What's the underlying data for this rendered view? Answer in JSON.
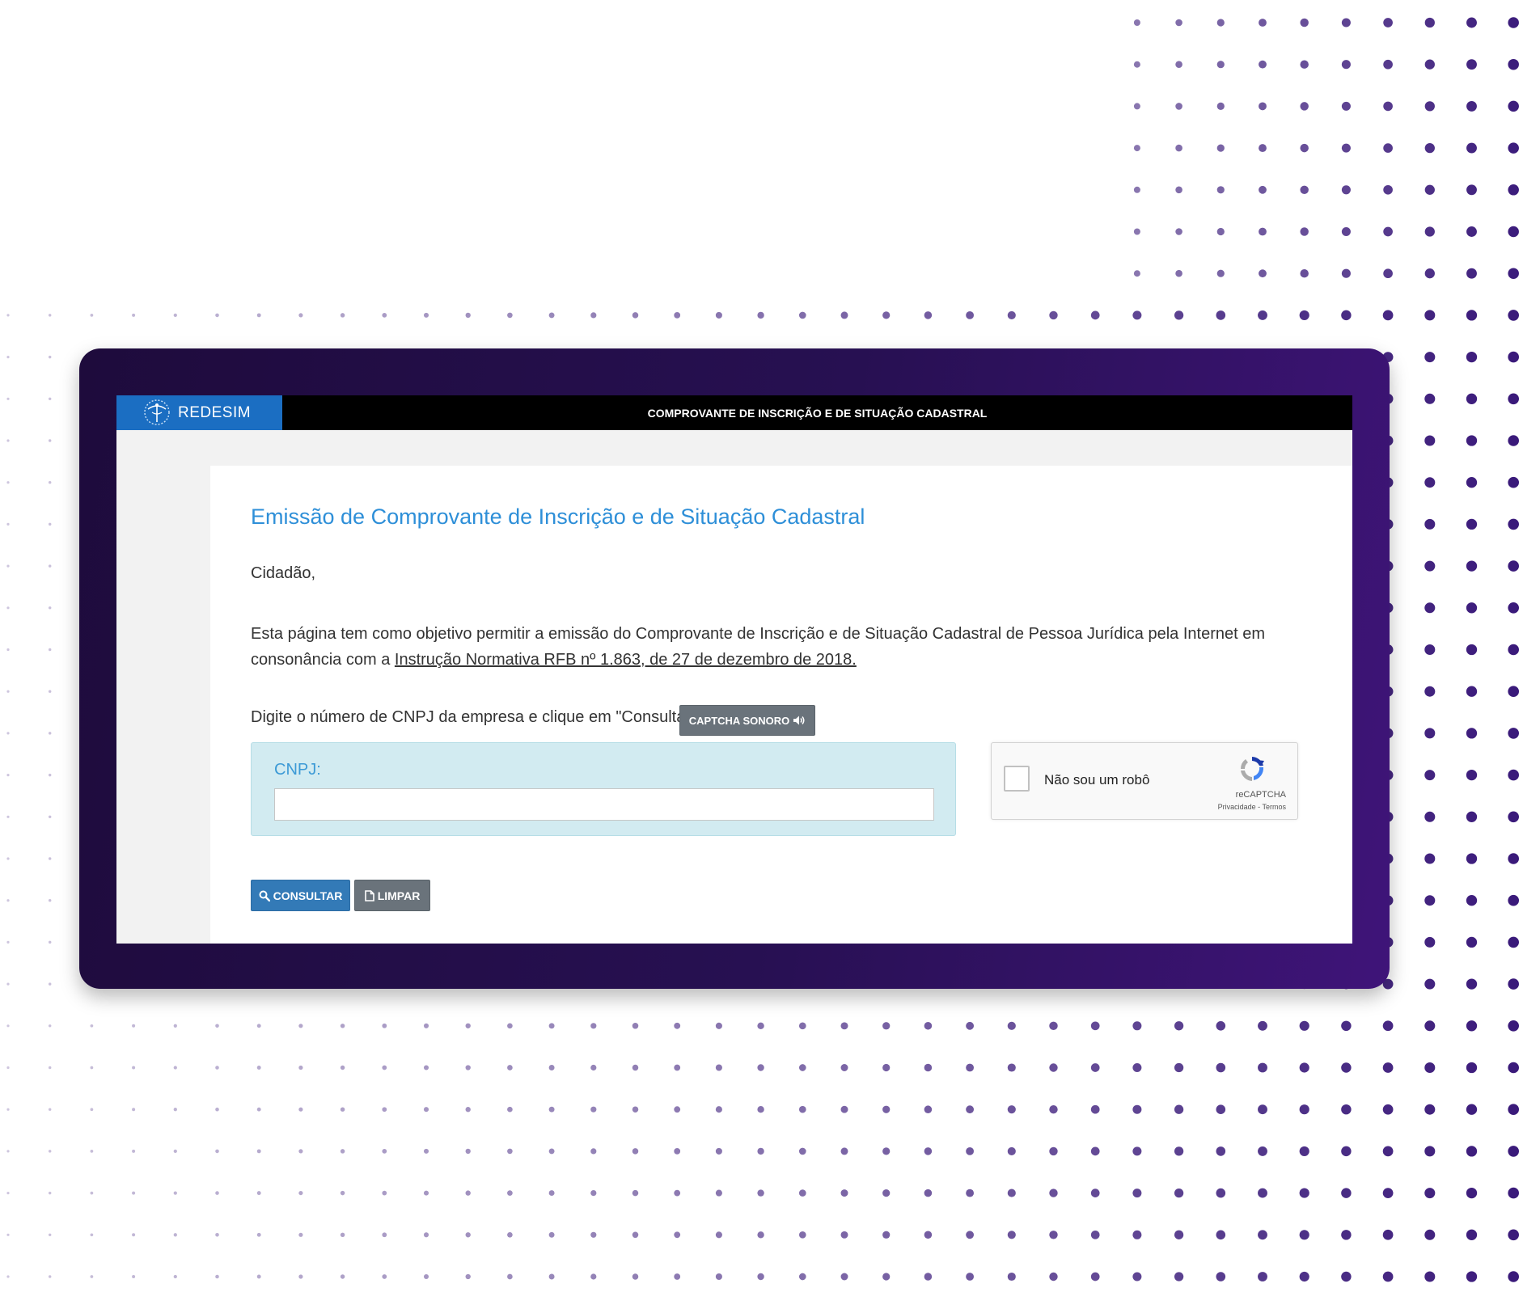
{
  "colors": {
    "frame_gradient": [
      "#1e0b3c",
      "#3f1479"
    ],
    "brand_blue": "#1b6ec2",
    "title_blue": "#2e8fd8",
    "dot_purple": "#3a1a7a",
    "cnpj_box_bg": "#d2ebf1",
    "button_primary": "#337ab7",
    "button_secondary": "#6a737b"
  },
  "header": {
    "brand_name": "REDESIM",
    "brand_icon": "redesim-globe-icon",
    "title": "COMPROVANTE DE INSCRIÇÃO E DE SITUAÇÃO CADASTRAL"
  },
  "main": {
    "title": "Emissão de Comprovante de Inscrição e de Situação Cadastral",
    "greeting": "Cidadão,",
    "intro_text": "Esta página tem como objetivo permitir a emissão do Comprovante de Inscrição e de Situação Cadastral de Pessoa Jurídica pela Internet em consonância com a ",
    "intro_link": "Instrução Normativa RFB nº 1.863, de 27 de dezembro de 2018.",
    "instruction": "Digite o número de CNPJ da empresa e clique em \"Consultar\".",
    "audio_captcha_label": "CAPTCHA SONORO",
    "audio_icon": "speaker-icon"
  },
  "form": {
    "cnpj_label": "CNPJ:",
    "cnpj_value": "",
    "cnpj_placeholder": ""
  },
  "recaptcha": {
    "label": "Não sou um robô",
    "checked": false,
    "brand": "reCAPTCHA",
    "links": "Privacidade - Termos"
  },
  "actions": {
    "consultar_label": "CONSULTAR",
    "consultar_icon": "search-icon",
    "limpar_label": "LIMPAR",
    "limpar_icon": "document-icon"
  }
}
